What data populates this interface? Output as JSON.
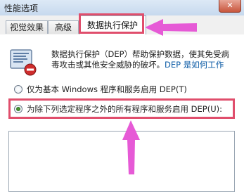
{
  "window": {
    "title": "性能选项",
    "close_label": "✕"
  },
  "tabs": [
    {
      "label": "视觉效果"
    },
    {
      "label": "高级"
    },
    {
      "label": "数据执行保护"
    }
  ],
  "dep": {
    "description_line1": "数据执行保护（DEP）帮助保护数据，使其免受病",
    "description_line2": "毒攻击或其他安全威胁的破坏。",
    "link_text": "DEP 是如何工作",
    "option1_label": "仅为基本 Windows 程序和服务启用 DEP(T)",
    "option2_label": "为除下列选定程序之外的所有程序和服务启用 DEP(U):",
    "selected_option": "option2",
    "program_list": []
  },
  "annotations": {
    "highlight_color": "#e04e6c",
    "arrow_color": "#e65ad6"
  }
}
